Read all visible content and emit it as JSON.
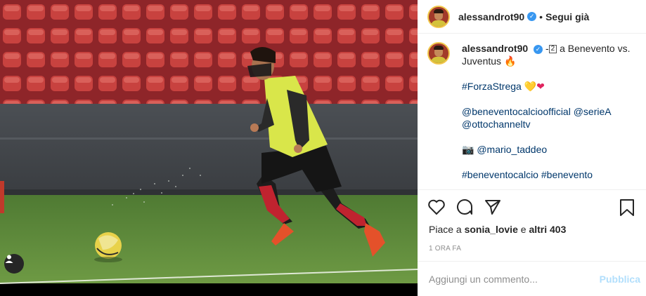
{
  "post": {
    "photo_alt": "Football training photo",
    "user_tag_icon": "user-tag-icon"
  },
  "header": {
    "username": "alessandrot90",
    "verified_icon": "verified-badge-icon",
    "separator": "•",
    "follow_label": "Segui già"
  },
  "caption": {
    "username": "alessandrot90",
    "line1_prefix": "-",
    "line1_box": "2",
    "line1_text": "a Benevento vs.",
    "line2_text": "Juventus",
    "line2_emoji": "🔥",
    "hashtag1": "#ForzaStrega",
    "hearts": [
      "💛",
      "❤"
    ],
    "mention1": "@beneventocalcioofficial",
    "mention2": "@serieA",
    "mention3": "@ottochanneltv",
    "camera_emoji": "📷",
    "mention4": "@mario_taddeo",
    "hashtag2": "#beneventocalcio",
    "hashtag3": "#benevento"
  },
  "actions": {
    "like_icon": "heart-icon",
    "comment_icon": "comment-icon",
    "share_icon": "share-icon",
    "save_icon": "bookmark-icon"
  },
  "likes": {
    "prefix": "Piace a",
    "user": "sonia_lovie",
    "middle": "e",
    "others": "altri 403"
  },
  "timestamp": "1 ORA FA",
  "comment": {
    "placeholder": "Aggiungi un commento...",
    "post_label": "Pubblica"
  },
  "colors": {
    "link": "#00376b",
    "verified": "#3897f0",
    "post_button": "#b2dffc",
    "stadium_seats": "#c0393b",
    "pitch": "#5a8a3a"
  }
}
